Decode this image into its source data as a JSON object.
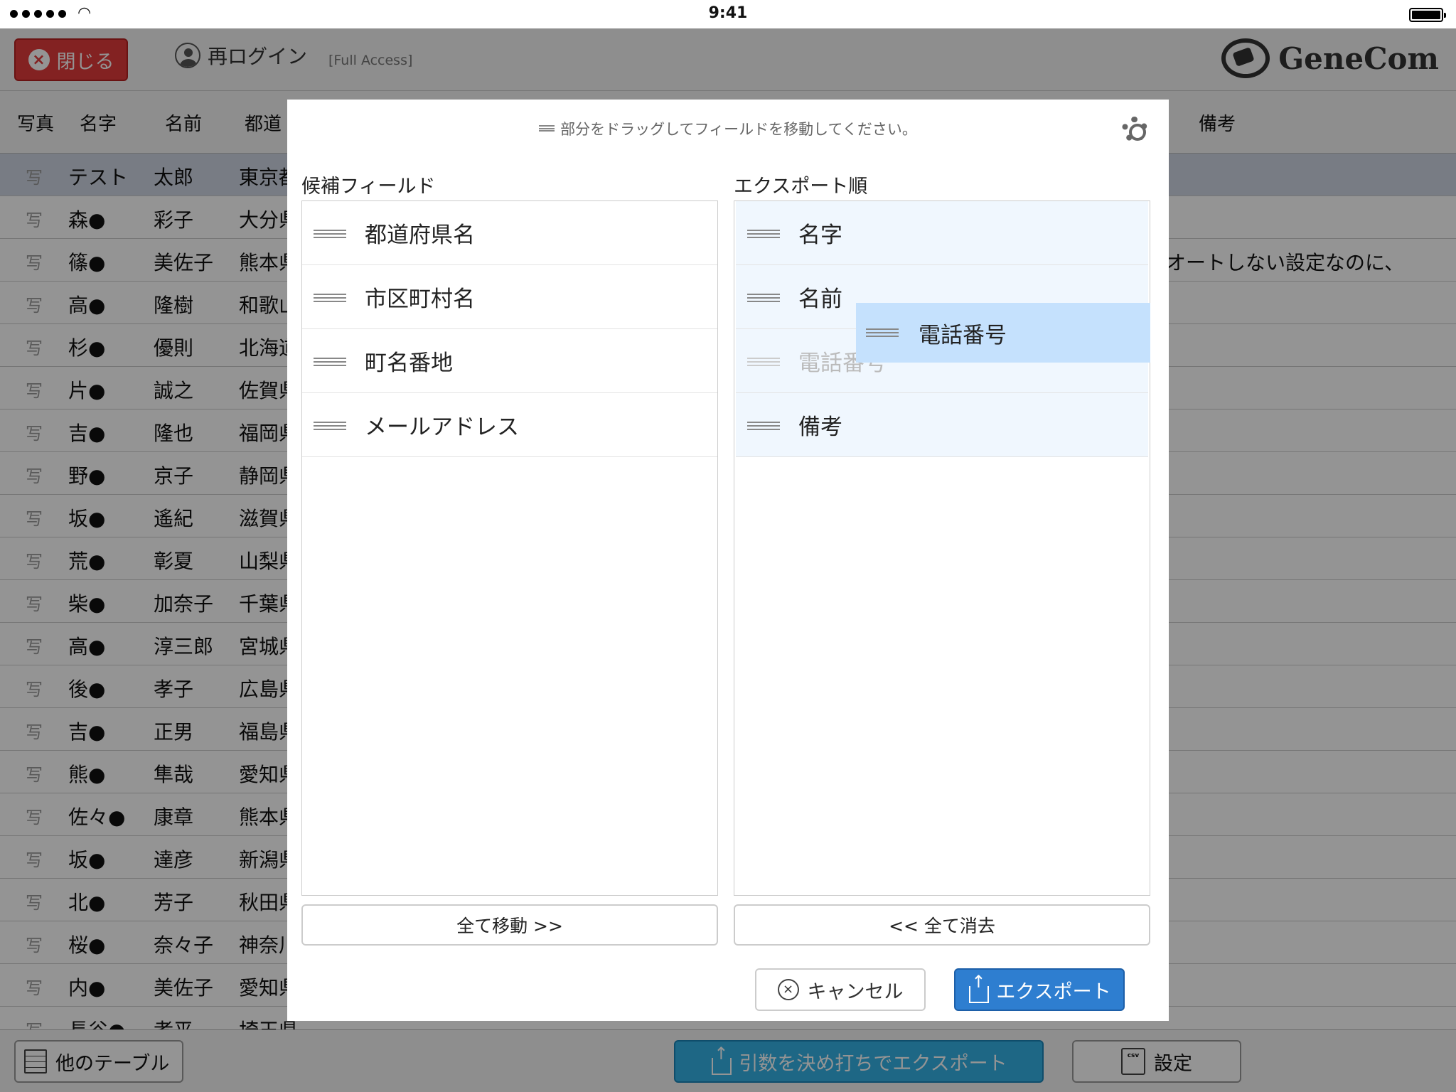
{
  "status_bar": {
    "time": "9:41",
    "signal_dots": 5,
    "battery_level": 1.0
  },
  "toolbar": {
    "close_label": "閉じる",
    "relogin_label": "再ログイン",
    "access_label": "[Full Access]",
    "logo_text": "GeneCom"
  },
  "table": {
    "headers": {
      "photo": "写真",
      "surname": "名字",
      "given": "名前",
      "pref": "都道",
      "note": "備考"
    },
    "rows": [
      {
        "photo": "写",
        "surname": "テスト",
        "given": "太郎",
        "pref": "東京都",
        "note": ""
      },
      {
        "photo": "写",
        "surname": "森●",
        "given": "彩子",
        "pref": "大分県",
        "note": ""
      },
      {
        "photo": "写",
        "surname": "篠●",
        "given": "美佐子",
        "pref": "熊本県",
        "note": "オートしない設定なのに、"
      },
      {
        "photo": "写",
        "surname": "高●",
        "given": "隆樹",
        "pref": "和歌山",
        "note": ""
      },
      {
        "photo": "写",
        "surname": "杉●",
        "given": "優則",
        "pref": "北海道",
        "note": ""
      },
      {
        "photo": "写",
        "surname": "片●",
        "given": "誠之",
        "pref": "佐賀県",
        "note": ""
      },
      {
        "photo": "写",
        "surname": "吉●",
        "given": "隆也",
        "pref": "福岡県",
        "note": ""
      },
      {
        "photo": "写",
        "surname": "野●",
        "given": "京子",
        "pref": "静岡県",
        "note": ""
      },
      {
        "photo": "写",
        "surname": "坂●",
        "given": "遙紀",
        "pref": "滋賀県",
        "note": ""
      },
      {
        "photo": "写",
        "surname": "荒●",
        "given": "彰夏",
        "pref": "山梨県",
        "note": ""
      },
      {
        "photo": "写",
        "surname": "柴●",
        "given": "加奈子",
        "pref": "千葉県",
        "note": ""
      },
      {
        "photo": "写",
        "surname": "高●",
        "given": "淳三郎",
        "pref": "宮城県",
        "note": ""
      },
      {
        "photo": "写",
        "surname": "後●",
        "given": "孝子",
        "pref": "広島県",
        "note": ""
      },
      {
        "photo": "写",
        "surname": "吉●",
        "given": "正男",
        "pref": "福島県",
        "note": ""
      },
      {
        "photo": "写",
        "surname": "熊●",
        "given": "隼哉",
        "pref": "愛知県",
        "note": ""
      },
      {
        "photo": "写",
        "surname": "佐々●",
        "given": "康章",
        "pref": "熊本県",
        "note": ""
      },
      {
        "photo": "写",
        "surname": "坂●",
        "given": "達彦",
        "pref": "新潟県",
        "note": ""
      },
      {
        "photo": "写",
        "surname": "北●",
        "given": "芳子",
        "pref": "秋田県",
        "note": ""
      },
      {
        "photo": "写",
        "surname": "桜●",
        "given": "奈々子",
        "pref": "神奈川",
        "note": ""
      },
      {
        "photo": "写",
        "surname": "内●",
        "given": "美佐子",
        "pref": "愛知県",
        "note": ""
      },
      {
        "photo": "写",
        "surname": "長谷●",
        "given": "孝平",
        "pref": "埼玉県",
        "note": ""
      }
    ]
  },
  "bottom_bar": {
    "other_tables_label": "他のテーブル",
    "fixed_export_label": "引数を決め打ちでエクスポート",
    "settings_label": "設定",
    "csv_badge": "csv"
  },
  "modal": {
    "hint": "部分をドラッグしてフィールドを移動してください。",
    "candidates_title": "候補フィールド",
    "order_title": "エクスポート順",
    "candidates": [
      "都道府県名",
      "市区町村名",
      "町名番地",
      "メールアドレス"
    ],
    "order": [
      "名字",
      "名前",
      "電話番号",
      "備考"
    ],
    "dragging_item": "電話番号",
    "move_all_label": "全て移動 >>",
    "clear_all_label": "<< 全て消去",
    "cancel_label": "キャンセル",
    "export_label": "エクスポート"
  }
}
